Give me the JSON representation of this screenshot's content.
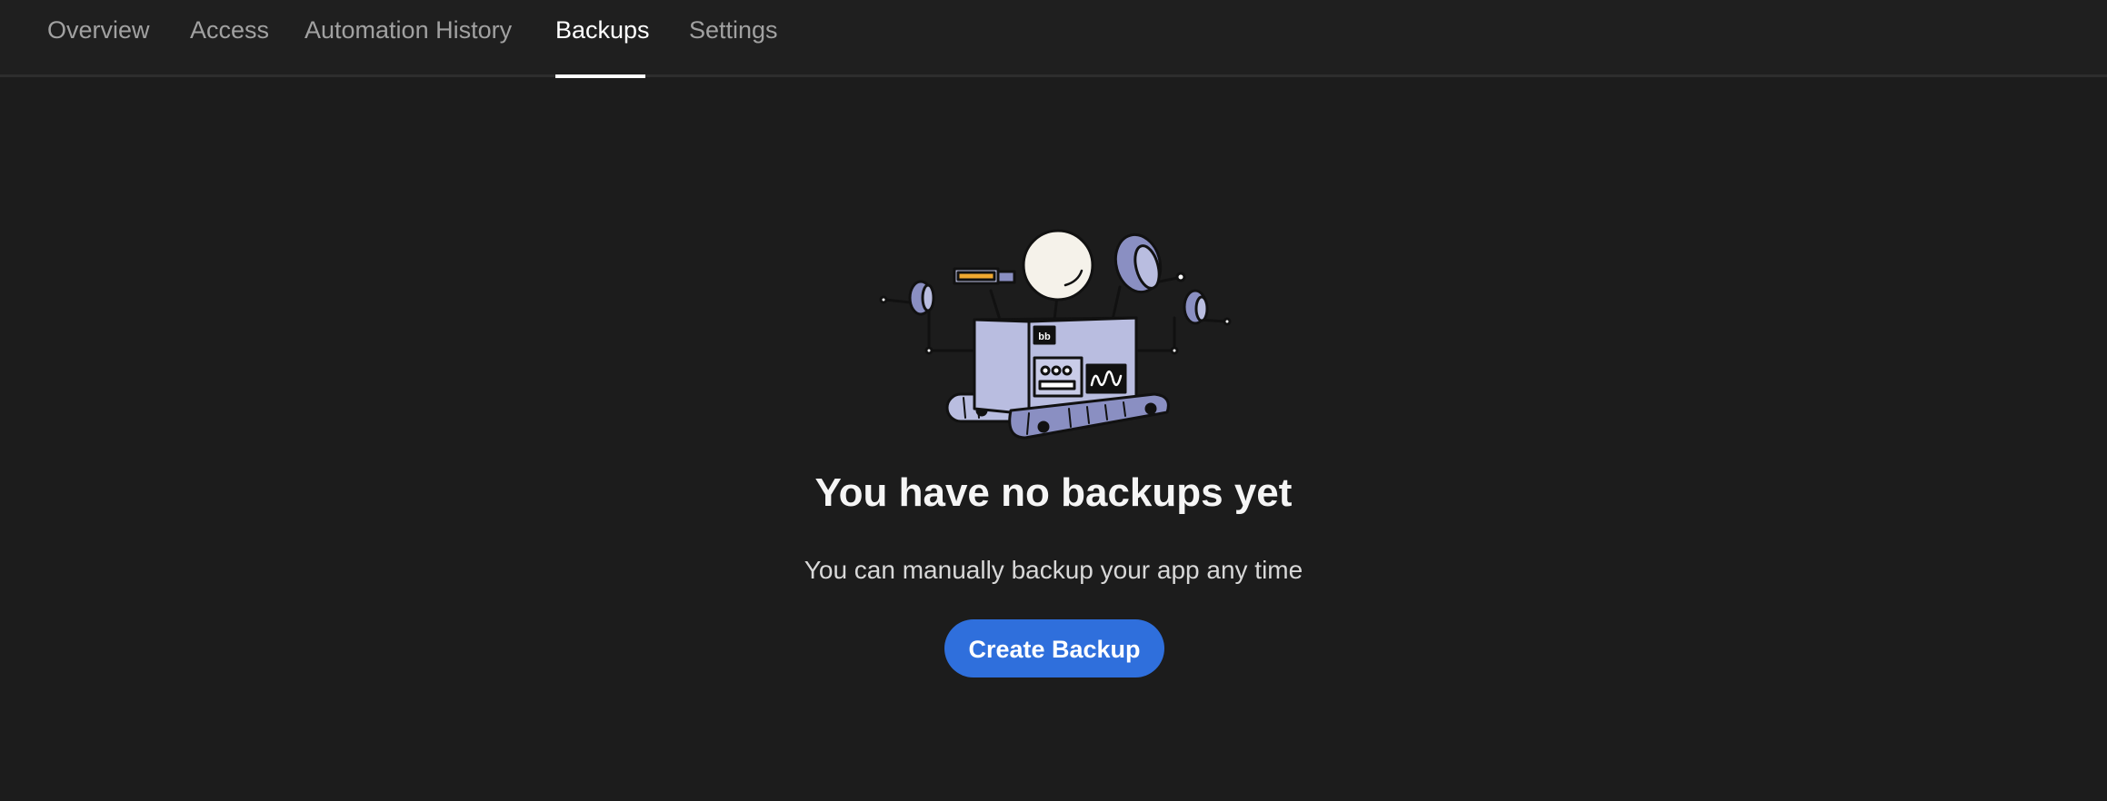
{
  "tabs": [
    {
      "label": "Overview",
      "active": false
    },
    {
      "label": "Access",
      "active": false
    },
    {
      "label": "Automation History",
      "active": false
    },
    {
      "label": "Backups",
      "active": true
    },
    {
      "label": "Settings",
      "active": false
    }
  ],
  "empty_state": {
    "title": "You have no backups yet",
    "description": "You can manually backup your app any time",
    "button_label": "Create Backup",
    "illustration": "robot-backup-illustration",
    "robot_badge": "bb"
  },
  "colors": {
    "background": "#1c1c1c",
    "tab_inactive": "#a1a1a1",
    "tab_active": "#ffffff",
    "button": "#2f6fdc",
    "robot_body": "#b9bde0",
    "robot_tread": "#8a8fc2"
  }
}
